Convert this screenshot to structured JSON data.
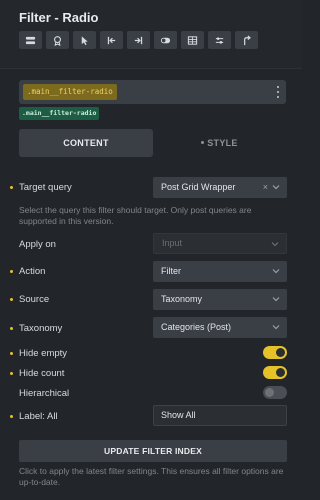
{
  "panel": {
    "title": "Filter - Radio"
  },
  "toolbar": {
    "icons": [
      "layers-icon",
      "badge-icon",
      "cursor-icon",
      "skip-start-icon",
      "skip-end-icon",
      "toggle-icon",
      "table-icon",
      "sliders-icon",
      "undo-arrow-icon"
    ]
  },
  "css_class": {
    "name": ".main__filter-radio",
    "tag": ".main__filter-radio"
  },
  "tabs": {
    "content": "CONTENT",
    "style": "STYLE"
  },
  "target_query": {
    "label": "Target query",
    "value": "Post Grid Wrapper",
    "clear": "×",
    "hint": "Select the query this filter should target. Only post queries are supported in this version."
  },
  "apply_on": {
    "label": "Apply on",
    "placeholder": "Input"
  },
  "action": {
    "label": "Action",
    "value": "Filter"
  },
  "source": {
    "label": "Source",
    "value": "Taxonomy"
  },
  "taxonomy": {
    "label": "Taxonomy",
    "value": "Categories (Post)"
  },
  "hide_empty": {
    "label": "Hide empty",
    "on": true
  },
  "hide_count": {
    "label": "Hide count",
    "on": true
  },
  "hierarchical": {
    "label": "Hierarchical",
    "on": false
  },
  "label_all": {
    "label": "Label: All",
    "value": "Show All"
  },
  "update": {
    "button": "UPDATE FILTER INDEX",
    "hint": "Click to apply the latest filter settings. This ensures all filter options are up-to-date."
  },
  "colors": {
    "accent": "#e6c229",
    "background": "#22262b",
    "control": "#3a3f45"
  }
}
